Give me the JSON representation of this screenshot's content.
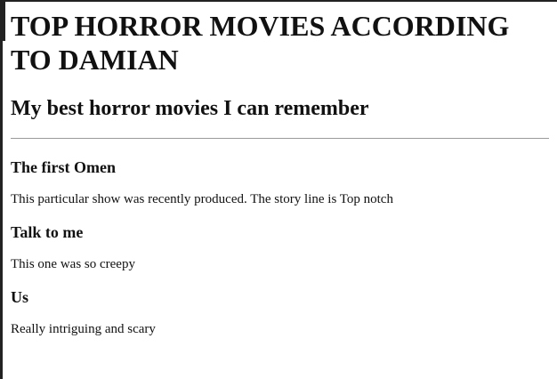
{
  "page": {
    "title": "TOP HORROR MOVIES ACCORDING TO DAMIAN",
    "subtitle": "My best horror movies I can remember"
  },
  "movies": [
    {
      "title": "The first Omen",
      "description": "This particular show was recently produced. The story line is Top notch"
    },
    {
      "title": "Talk to me",
      "description": "This one was so creepy"
    },
    {
      "title": "Us",
      "description": "Really intriguing and scary"
    }
  ]
}
